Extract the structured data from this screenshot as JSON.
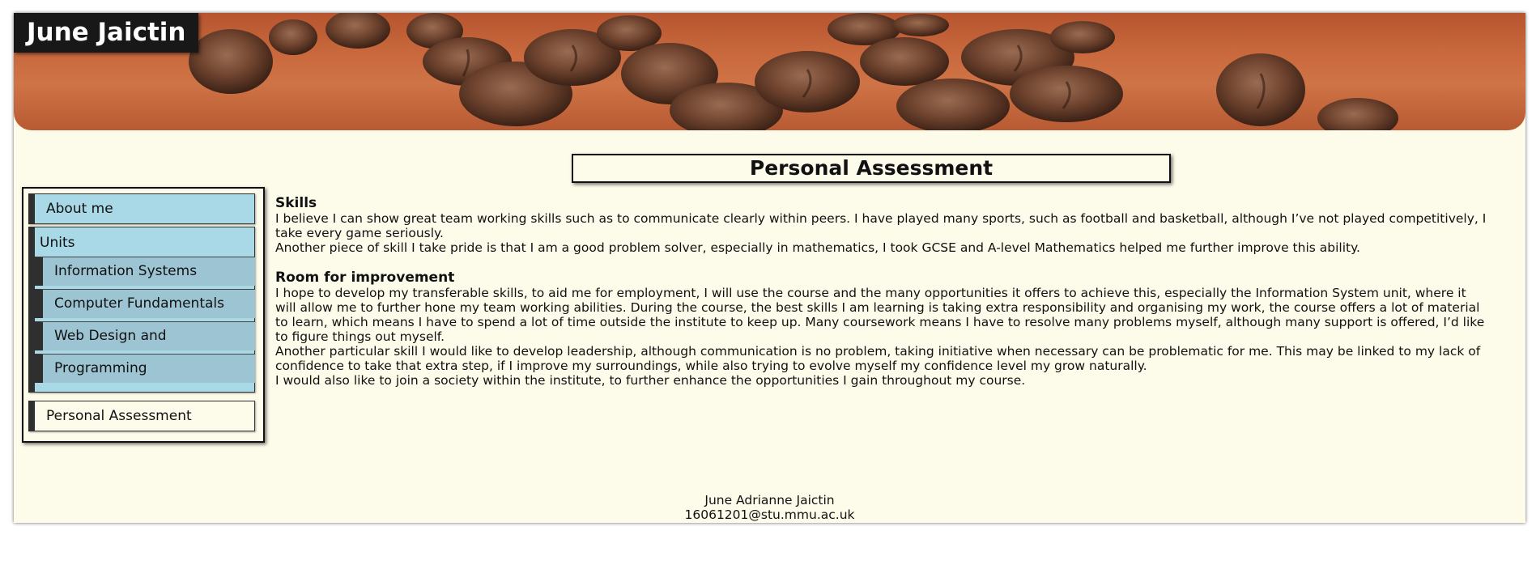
{
  "header": {
    "site_title": "June Jaictin"
  },
  "page_title": "Personal Assessment",
  "nav": {
    "about": "About me",
    "units": "Units",
    "sub_items": [
      "Information Systems",
      "Computer Fundamentals",
      "Web Design and Development",
      "Programming"
    ],
    "assessment": "Personal Assessment"
  },
  "content": {
    "skills_heading": "Skills",
    "skills_p1": "I believe I can show great team working skills such as to communicate clearly within peers. I have played many sports, such as football and basketball, although I’ve not played competitively, I take every game seriously.",
    "skills_p2": "Another piece of skill I take pride is that I am a good problem solver, especially in mathematics, I took GCSE and A-level Mathematics helped me further improve this ability.",
    "improve_heading": "Room for improvement",
    "improve_p1": "I hope to develop my transferable skills, to aid me for employment, I will use the course and the many opportunities it offers to achieve this, especially the Information System unit, where it will allow me to further hone my team working abilities. During the course, the best skills I am learning is taking extra responsibility and organising my work, the course offers a lot of material to learn, which means I have to spend a lot of time outside the institute to keep up. Many coursework means I have to resolve many problems myself, although many support is offered, I’d like to figure things out myself.",
    "improve_p2": "Another particular skill I would like to develop leadership, although communication is no problem, taking initiative when necessary can be problematic for me. This may be linked to my lack of confidence to take that extra step, if I improve my surroundings, while also trying to evolve myself my confidence level my grow naturally.",
    "improve_p3": "I would also like to join a society within the institute, to further enhance the opportunities I gain throughout my course."
  },
  "footer": {
    "name": "June Adrianne Jaictin",
    "email": "16061201@stu.mmu.ac.uk"
  }
}
